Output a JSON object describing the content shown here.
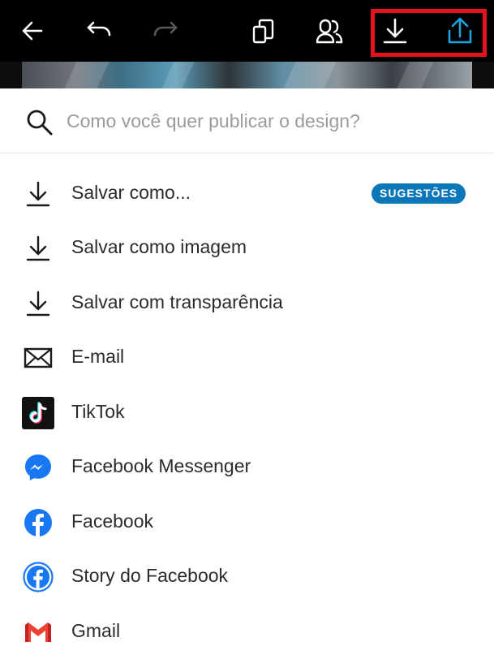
{
  "toolbar": {
    "icons": [
      "back-arrow-icon",
      "undo-icon",
      "redo-icon",
      "pages-icon",
      "share-people-icon",
      "download-icon",
      "publish-upload-icon"
    ],
    "colors": {
      "background": "#000000",
      "icon": "#ffffff",
      "disabled_icon": "#5a5a5a",
      "upload_accent": "#1ba3e0",
      "highlight": "#e8121a"
    }
  },
  "search": {
    "placeholder": "Como você quer publicar o design?",
    "value": ""
  },
  "options": [
    {
      "label": "Salvar como...",
      "icon": "download-icon",
      "badge": "SUGESTÕES"
    },
    {
      "label": "Salvar como imagem",
      "icon": "download-icon"
    },
    {
      "label": "Salvar com transparência",
      "icon": "download-icon"
    },
    {
      "label": "E-mail",
      "icon": "envelope-icon"
    },
    {
      "label": "TikTok",
      "icon": "tiktok-icon"
    },
    {
      "label": "Facebook Messenger",
      "icon": "messenger-icon"
    },
    {
      "label": "Facebook",
      "icon": "facebook-icon"
    },
    {
      "label": "Story do Facebook",
      "icon": "facebook-story-icon"
    },
    {
      "label": "Gmail",
      "icon": "gmail-icon"
    }
  ],
  "colors": {
    "badge": "#0b76b8",
    "facebook_blue": "#1877f2",
    "gmail_red": "#ea4335"
  }
}
